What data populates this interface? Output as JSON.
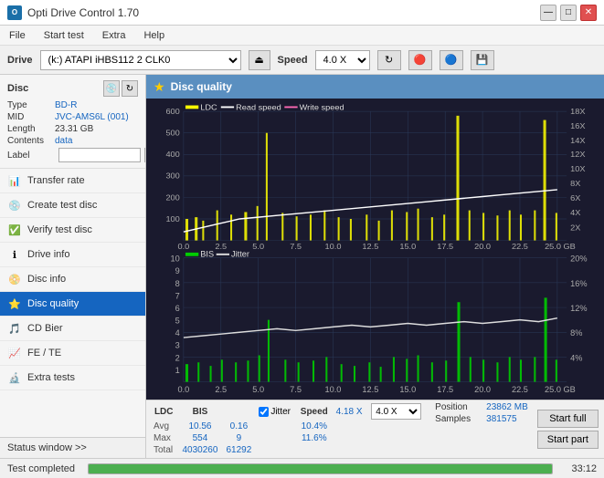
{
  "titleBar": {
    "icon": "O",
    "title": "Opti Drive Control 1.70",
    "minimize": "—",
    "maximize": "□",
    "close": "✕"
  },
  "menuBar": {
    "items": [
      "File",
      "Start test",
      "Extra",
      "Help"
    ]
  },
  "driveBar": {
    "label": "Drive",
    "driveValue": "(k:) ATAPI iHBS112  2 CLK0",
    "speedLabel": "Speed",
    "speedValue": "4.0 X"
  },
  "disc": {
    "title": "Disc",
    "typeLabel": "Type",
    "typeValue": "BD-R",
    "midLabel": "MID",
    "midValue": "JVC-AMS6L (001)",
    "lengthLabel": "Length",
    "lengthValue": "23.31 GB",
    "contentsLabel": "Contents",
    "contentsValue": "data",
    "labelLabel": "Label",
    "labelValue": ""
  },
  "nav": {
    "items": [
      {
        "id": "transfer-rate",
        "label": "Transfer rate",
        "icon": "📊"
      },
      {
        "id": "create-test-disc",
        "label": "Create test disc",
        "icon": "💿"
      },
      {
        "id": "verify-test-disc",
        "label": "Verify test disc",
        "icon": "✅"
      },
      {
        "id": "drive-info",
        "label": "Drive info",
        "icon": "ℹ"
      },
      {
        "id": "disc-info",
        "label": "Disc info",
        "icon": "📀"
      },
      {
        "id": "disc-quality",
        "label": "Disc quality",
        "icon": "⭐",
        "active": true
      },
      {
        "id": "cd-bier",
        "label": "CD Bier",
        "icon": "🎵"
      },
      {
        "id": "fe-te",
        "label": "FE / TE",
        "icon": "📈"
      },
      {
        "id": "extra-tests",
        "label": "Extra tests",
        "icon": "🔬"
      }
    ],
    "statusWindow": "Status window >>"
  },
  "chart": {
    "title": "Disc quality",
    "icon": "★",
    "legend": {
      "ldc": {
        "label": "LDC",
        "color": "#ffff00"
      },
      "readSpeed": {
        "label": "Read speed",
        "color": "#ffffff"
      },
      "writeSpeed": {
        "label": "Write speed",
        "color": "#ff69b4"
      }
    },
    "legend2": {
      "bis": {
        "label": "BIS",
        "color": "#00cc00"
      },
      "jitter": {
        "label": "Jitter",
        "color": "#ffffff"
      }
    },
    "yAxisLeft1": [
      600,
      500,
      400,
      300,
      200,
      100
    ],
    "yAxisRight1": [
      "18X",
      "16X",
      "14X",
      "12X",
      "10X",
      "8X",
      "6X",
      "4X",
      "2X"
    ],
    "xAxis1": [
      "0.0",
      "2.5",
      "5.0",
      "7.5",
      "10.0",
      "12.5",
      "15.0",
      "17.5",
      "20.0",
      "22.5",
      "25.0"
    ],
    "yAxisLeft2": [
      10,
      9,
      8,
      7,
      6,
      5,
      4,
      3,
      2,
      1
    ],
    "yAxisRight2": [
      "20%",
      "16%",
      "12%",
      "8%",
      "4%"
    ],
    "xAxis2": [
      "0.0",
      "2.5",
      "5.0",
      "7.5",
      "10.0",
      "12.5",
      "15.0",
      "17.5",
      "20.0",
      "22.5",
      "25.0"
    ],
    "stats": {
      "ldcLabel": "LDC",
      "bisLabel": "BIS",
      "jitterLabel": "Jitter",
      "speedLabel": "Speed",
      "speedValue": "4.18 X",
      "speedSelect": "4.0 X",
      "avgLabel": "Avg",
      "avgLdc": "10.56",
      "avgBis": "0.16",
      "avgJitter": "10.4%",
      "maxLabel": "Max",
      "maxLdc": "554",
      "maxBis": "9",
      "maxJitter": "11.6%",
      "totalLabel": "Total",
      "totalLdc": "4030260",
      "totalBis": "61292",
      "positionLabel": "Position",
      "positionValue": "23862 MB",
      "samplesLabel": "Samples",
      "samplesValue": "381575",
      "jitterChecked": true
    },
    "buttons": {
      "startFull": "Start full",
      "startPart": "Start part"
    }
  },
  "statusBar": {
    "text": "Test completed",
    "progress": 100,
    "time": "33:12"
  }
}
